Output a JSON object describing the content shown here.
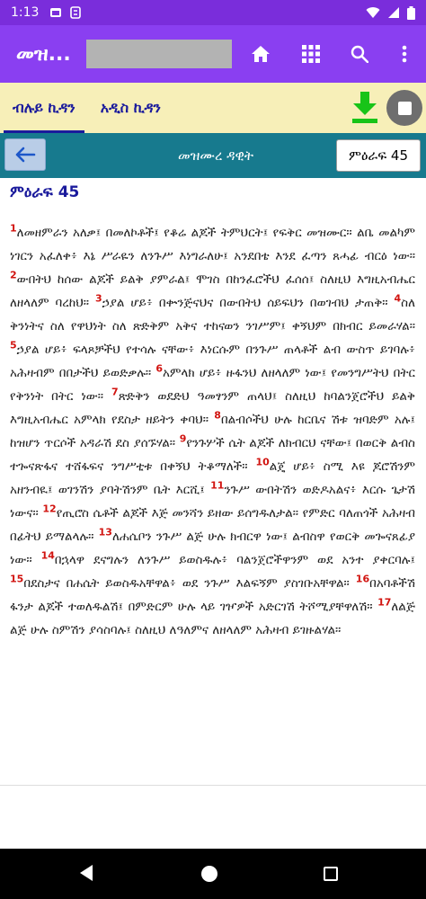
{
  "status": {
    "time": "1:13"
  },
  "appbar": {
    "title": "መዝ..."
  },
  "tabs": [
    {
      "label": "ብሉይ ኪዳን"
    },
    {
      "label": "አዲስ ኪዳን"
    }
  ],
  "nav": {
    "book_title": "መዝሙረ ዳዊት",
    "chapter_label": "ምዕራፍ 45"
  },
  "content": {
    "heading": "ምዕራፍ 45",
    "verses": [
      {
        "n": "1",
        "t": "ለመዘምራን አለቃ፤ በመለኮቶች፤ የቆሬ ልጆች ትምህርት፤ የፍቅር መዝሙር። ልቤ መልካም ነገርን አፈለቀ፥ እኔ ሥራዬን ለንጉሥ እነግራለሁ፤ አንደበቴ እንደ ፈጣን ጸሓፊ ብርዕ ነው።"
      },
      {
        "n": "2",
        "t": "ውበትህ ከሰው ልጆች ይልቅ ያምራል፤ ሞገስ በከንፈሮችህ ፈሰሰ፤ ስለዚህ እግዚአብሔር ለዘላለም ባረከህ።"
      },
      {
        "n": "3",
        "t": "ኃያል ሆይ፥ በቍንጅናህና በውበትህ ሰይፍህን በወገብህ ታጠቅ።"
      },
      {
        "n": "4",
        "t": "ስለ ቅንነትና ስለ የዋህነት ስለ ጽድቅም አቅና ተከናወን ንገሥም፤ ቀኝህም በክብር ይመራሃል።"
      },
      {
        "n": "5",
        "t": "ኃያል ሆይ፥ ፍላጾቻችህ የተሳሉ ናቸው፥ እነርሱም በንጉሥ ጠላቶች ልብ ውስጥ ይገባሉ፥ አሕዛብም በበታችህ ይወድቃሉ።"
      },
      {
        "n": "6",
        "t": "አምላክ ሆይ፥ ዙፋንህ ለዘላለም ነው፤ የመንግሥትህ በትር የቅንነት በትር ነው።"
      },
      {
        "n": "7",
        "t": "ጽድቅን ወደድህ ዓመፃንም ጠላህ፤ ስለዚህ ከባልንጀሮችህ ይልቅ እግዚአብሔር አምላክ የደስታ ዘይትን ቀባህ።"
      },
      {
        "n": "8",
        "t": "በልብሶችህ ሁሉ ከርቤና ሽቱ ዝባድም አሉ፤ ከዝሆን ጥርሶች አዳራሽ ደስ ያሰኙሃል።"
      },
      {
        "n": "9",
        "t": "የንጉሦች ሴት ልጆች ለክብርህ ናቸው፤ በወርቅ ልብስ ተጐናጽፋና ተሸፋፍና ንግሥቲቱ በቀኝህ ትቆማለች።"
      },
      {
        "n": "10",
        "t": "ልጄ ሆይ፥ ስሚ እዩ ጆሮሽንም አዘንብዪ፤ ወገንሽን ያባትሽንም ቤት እርሺ፤"
      },
      {
        "n": "11",
        "t": "ንጉሥ ውበትሽን ወድዶአልና፥ እርሱ ጌታሽ ነውና።"
      },
      {
        "n": "12",
        "t": "የጢሮስ ሴቶች ልጆች እጅ መንሻን ይዘው ይሰግዱለታል። የምድር ባለጠጎች አሕዛብ በፊትህ ይማልላሉ።"
      },
      {
        "n": "13",
        "t": "ለሐሴቦን ንጉሥ ልጅ ሁሉ ክብርዋ ነው፤ ልብስዋ የወርቅ መጐናጸፊያ ነው።"
      },
      {
        "n": "14",
        "t": "በኋላዋ ደናግሉን ለንጉሥ ይወስዱሉ፥ ባልንጀሮችዋንም ወደ አንተ ያቀርባሉ፤"
      },
      {
        "n": "15",
        "t": "በደስታና በሐሴት ይወስዱአቸዋል፥ ወደ ንጉሥ እልፍኝም ያስገቡአቸዋል።"
      },
      {
        "n": "16",
        "t": "በአባቶችሽ ፋንታ ልጆች ተወለዱልሽ፤ በምድርም ሁሉ ላይ ገዦዎች አድርገሽ ትሾሚያቸዋለሽ።"
      },
      {
        "n": "17",
        "t": "ለልጅ ልጅ ሁሉ ስምሽን ያሳስባሉ፤ ስለዚህ ለዓለምና ለዘላለም አሕዛብ ይገዙልሃል።"
      }
    ]
  },
  "colors": {
    "status_bar": "#7a2ddb",
    "app_bar": "#8a3ff1",
    "tab_bar": "#f7efb8",
    "tab_text": "#1a1a9c",
    "nav_bar": "#177a8e",
    "verse_number": "#d1130f",
    "download_icon": "#18c418"
  },
  "icons": {
    "status": [
      "gallery-icon",
      "sync-icon",
      "wifi-icon",
      "signal-icon",
      "battery-icon"
    ],
    "appbar": [
      "home-icon",
      "grid-icon",
      "search-icon",
      "overflow-menu-icon"
    ],
    "tabs": [
      "download-icon",
      "stop-icon"
    ],
    "nav": [
      "arrow-left-icon"
    ],
    "system": [
      "back-triangle-icon",
      "home-circle-icon",
      "recents-square-icon"
    ]
  }
}
